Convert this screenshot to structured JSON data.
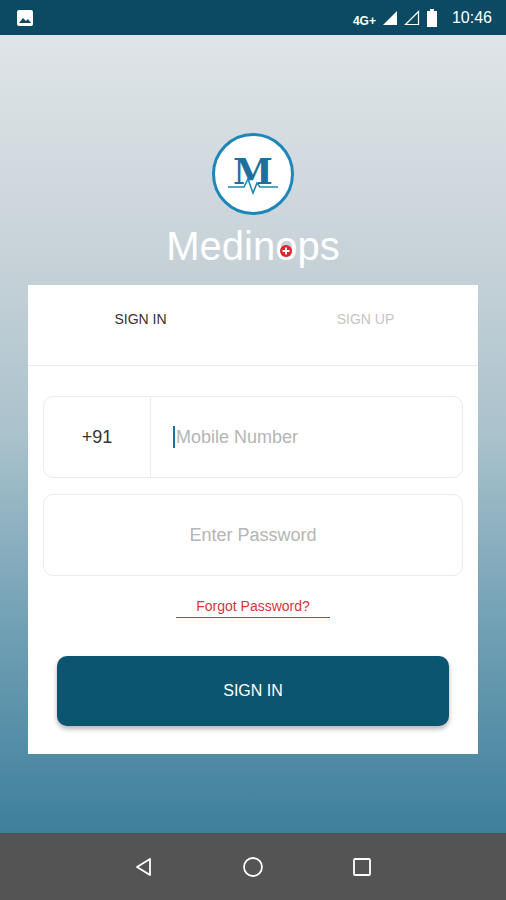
{
  "status_bar": {
    "network": "4G+",
    "time": "10:46"
  },
  "logo": {
    "mark": "M"
  },
  "brand": {
    "parts": [
      "Medin",
      "o",
      "ps"
    ]
  },
  "tabs": [
    {
      "label": "SIGN IN",
      "selected": true
    },
    {
      "label": "SIGN UP",
      "selected": false
    }
  ],
  "phone": {
    "country_code": "+91",
    "placeholder": "Mobile Number",
    "focused": true
  },
  "password": {
    "placeholder": "Enter Password"
  },
  "forgot_link": "Forgot Password?",
  "submit_button": "SIGN IN"
}
